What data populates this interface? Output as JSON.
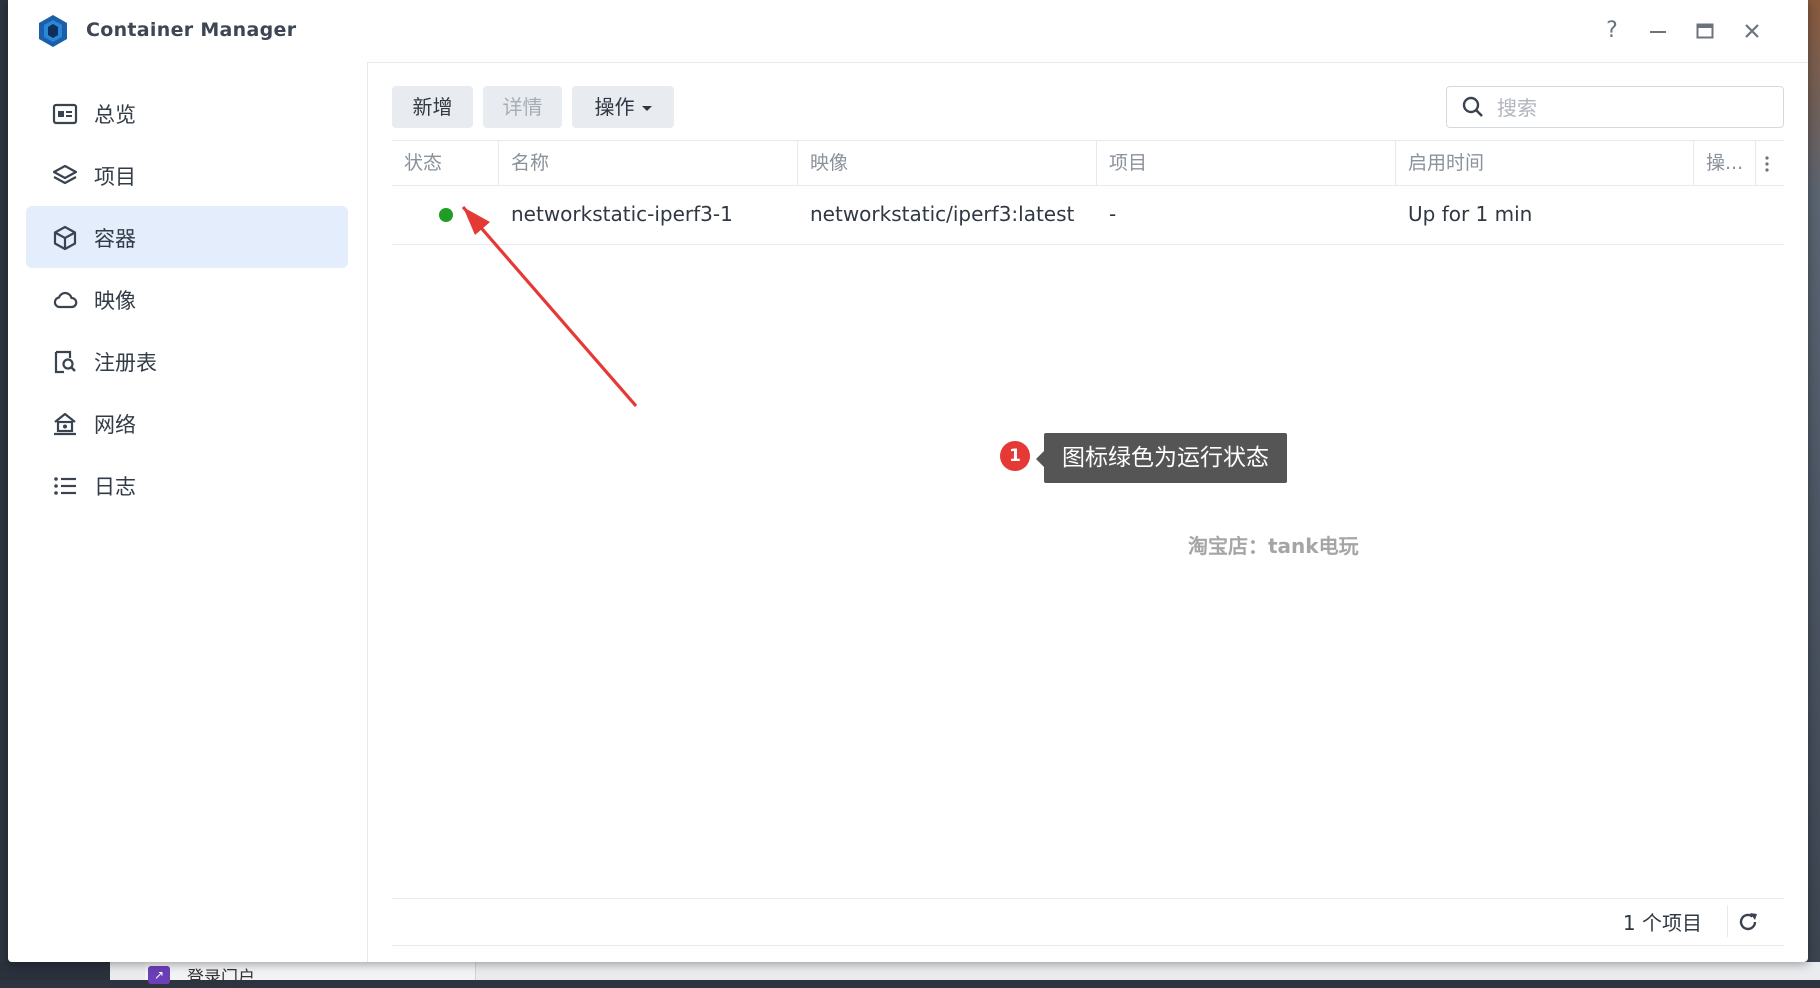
{
  "window": {
    "title": "Container Manager"
  },
  "titlebar": {
    "help": "?",
    "minimize": "—",
    "maximize": "▭",
    "close": "✕"
  },
  "sidebar": {
    "items": [
      {
        "label": "总览",
        "icon": "overview-icon"
      },
      {
        "label": "项目",
        "icon": "layers-icon"
      },
      {
        "label": "容器",
        "icon": "cube-icon",
        "active": true
      },
      {
        "label": "映像",
        "icon": "cloud-icon"
      },
      {
        "label": "注册表",
        "icon": "registry-search-icon"
      },
      {
        "label": "网络",
        "icon": "network-icon"
      },
      {
        "label": "日志",
        "icon": "list-icon"
      }
    ]
  },
  "toolbar": {
    "create": "新增",
    "details": "详情",
    "action": "操作"
  },
  "search": {
    "placeholder": "搜索"
  },
  "table": {
    "columns": [
      "状态",
      "名称",
      "映像",
      "项目",
      "启用时间",
      "操..."
    ],
    "rows": [
      {
        "status": "running",
        "status_color": "#1f9d24",
        "name": "networkstatic-iperf3-1",
        "image": "networkstatic/iperf3:latest",
        "project": "-",
        "uptime": "Up for 1 min"
      }
    ]
  },
  "annotation": {
    "number": "1",
    "text": "图标绿色为运行状态",
    "arrow_color": "#e53935"
  },
  "watermark": "淘宝店：tank电玩",
  "footer": {
    "count": "1 个项目"
  },
  "taskbar": {
    "item": "登录门户"
  }
}
